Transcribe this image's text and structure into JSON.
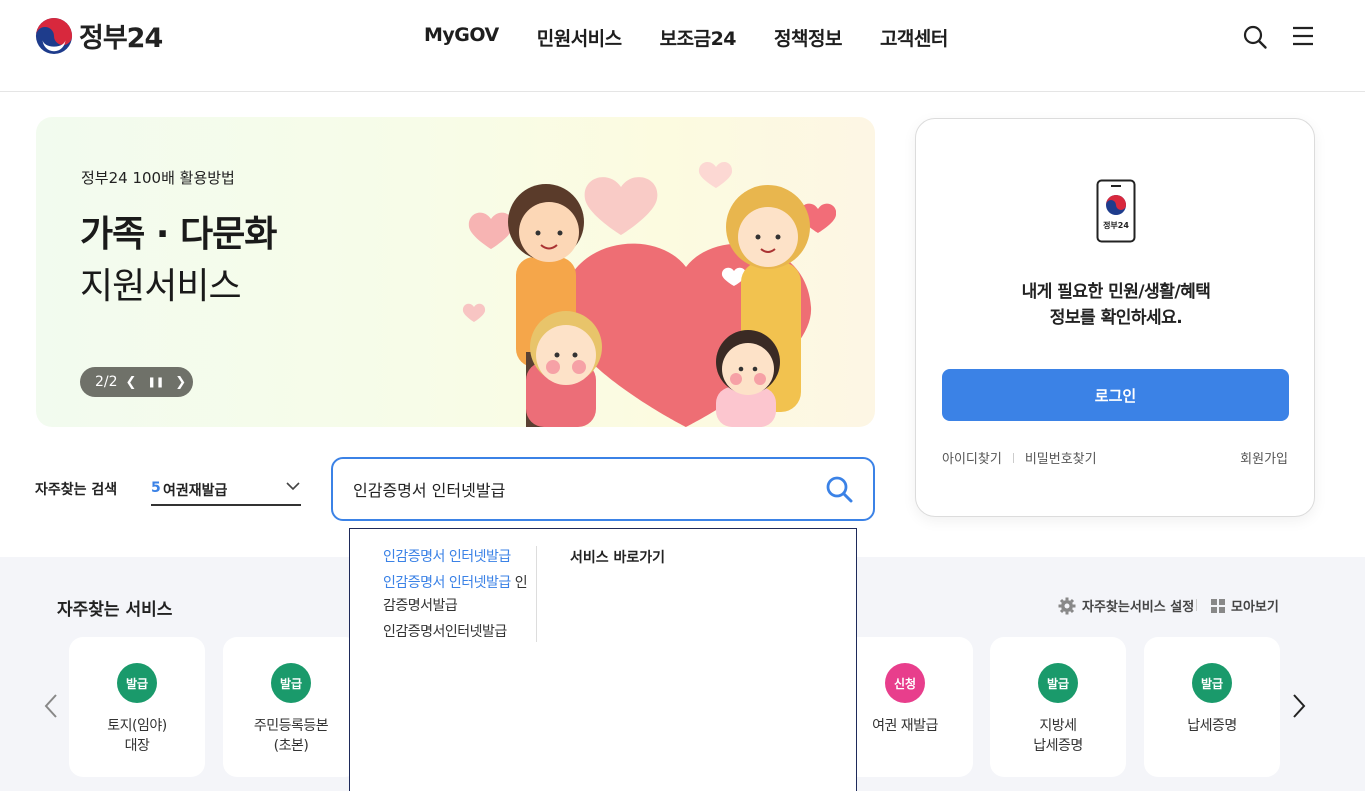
{
  "header": {
    "logo_text": "정부24",
    "nav": [
      "MyGOV",
      "민원서비스",
      "보조금24",
      "정책정보",
      "고객센터"
    ]
  },
  "banner": {
    "subtitle": "정부24 100배 활용방법",
    "title_bold": "가족 · 다문화",
    "title_light": "지원서비스",
    "pager": "2/2"
  },
  "login": {
    "phone_label": "정부24",
    "message_line1": "내게 필요한 민원/생활/혜택",
    "message_line2": "정보를 확인하세요.",
    "button": "로그인",
    "find_id": "아이디찾기",
    "find_pw": "비밀번호찾기",
    "join": "회원가입"
  },
  "search": {
    "freq_label": "자주찾는 검색",
    "freq_rank": "5",
    "freq_value": "여권재발급",
    "query": "인감증명서 인터넷발급"
  },
  "autocomplete": {
    "item1": "인감증명서 인터넷발급",
    "item2_hl": "인감증명서 인터넷발급",
    "item2_rest": " 인감증명서발급",
    "item3": "인감증명서인터넷발급",
    "shortcut_title": "서비스 바로가기"
  },
  "services": {
    "title": "자주찾는 서비스",
    "settings": "자주찾는서비스 설정",
    "view_all": "모아보기",
    "cards": [
      {
        "badge": "발급",
        "line1": "토지(임야)",
        "line2": "대장",
        "color": "#1a9a6b"
      },
      {
        "badge": "발급",
        "line1": "주민등록등본",
        "line2": "(초본)",
        "color": "#1a9a6b"
      },
      {
        "badge": "신청",
        "line1": "여권 재발급",
        "line2": "",
        "color": "#e83e8c"
      },
      {
        "badge": "발급",
        "line1": "지방세",
        "line2": "납세증명",
        "color": "#1a9a6b"
      },
      {
        "badge": "발급",
        "line1": "납세증명",
        "line2": "",
        "color": "#1a9a6b"
      }
    ]
  },
  "colors": {
    "accent": "#3b82e6",
    "issue_badge": "#1a9a6b",
    "apply_badge": "#e83e8c"
  }
}
